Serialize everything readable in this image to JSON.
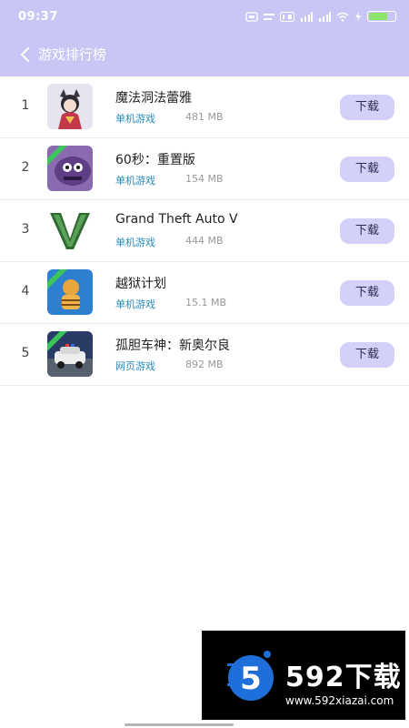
{
  "status_bar": {
    "time": "09:37",
    "battery": ""
  },
  "header": {
    "title": "游戏排行榜"
  },
  "download_label": "下载",
  "games": [
    {
      "rank": "1",
      "name": "魔法洞法蕾雅",
      "category": "单机游戏",
      "size": "481 MB",
      "icon": "anime-girl-icon"
    },
    {
      "rank": "2",
      "name": "60秒：重置版",
      "category": "单机游戏",
      "size": "154 MB",
      "icon": "purple-monster-icon"
    },
    {
      "rank": "3",
      "name": "Grand Theft Auto V",
      "category": "单机游戏",
      "size": "444 MB",
      "icon": "gta-v-logo-icon"
    },
    {
      "rank": "4",
      "name": "越狱计划",
      "category": "单机游戏",
      "size": "15.1 MB",
      "icon": "prisoner-character-icon"
    },
    {
      "rank": "5",
      "name": "孤胆车神：新奥尔良",
      "category": "网页游戏",
      "size": "892 MB",
      "icon": "police-car-icon"
    }
  ],
  "watermark": {
    "brand": "592下载",
    "url": "www.592xiazai.com",
    "logo_digit": "5"
  },
  "colors": {
    "header": "#c9c6f5",
    "button": "#d3d1f7",
    "category": "#2a8ab8"
  }
}
